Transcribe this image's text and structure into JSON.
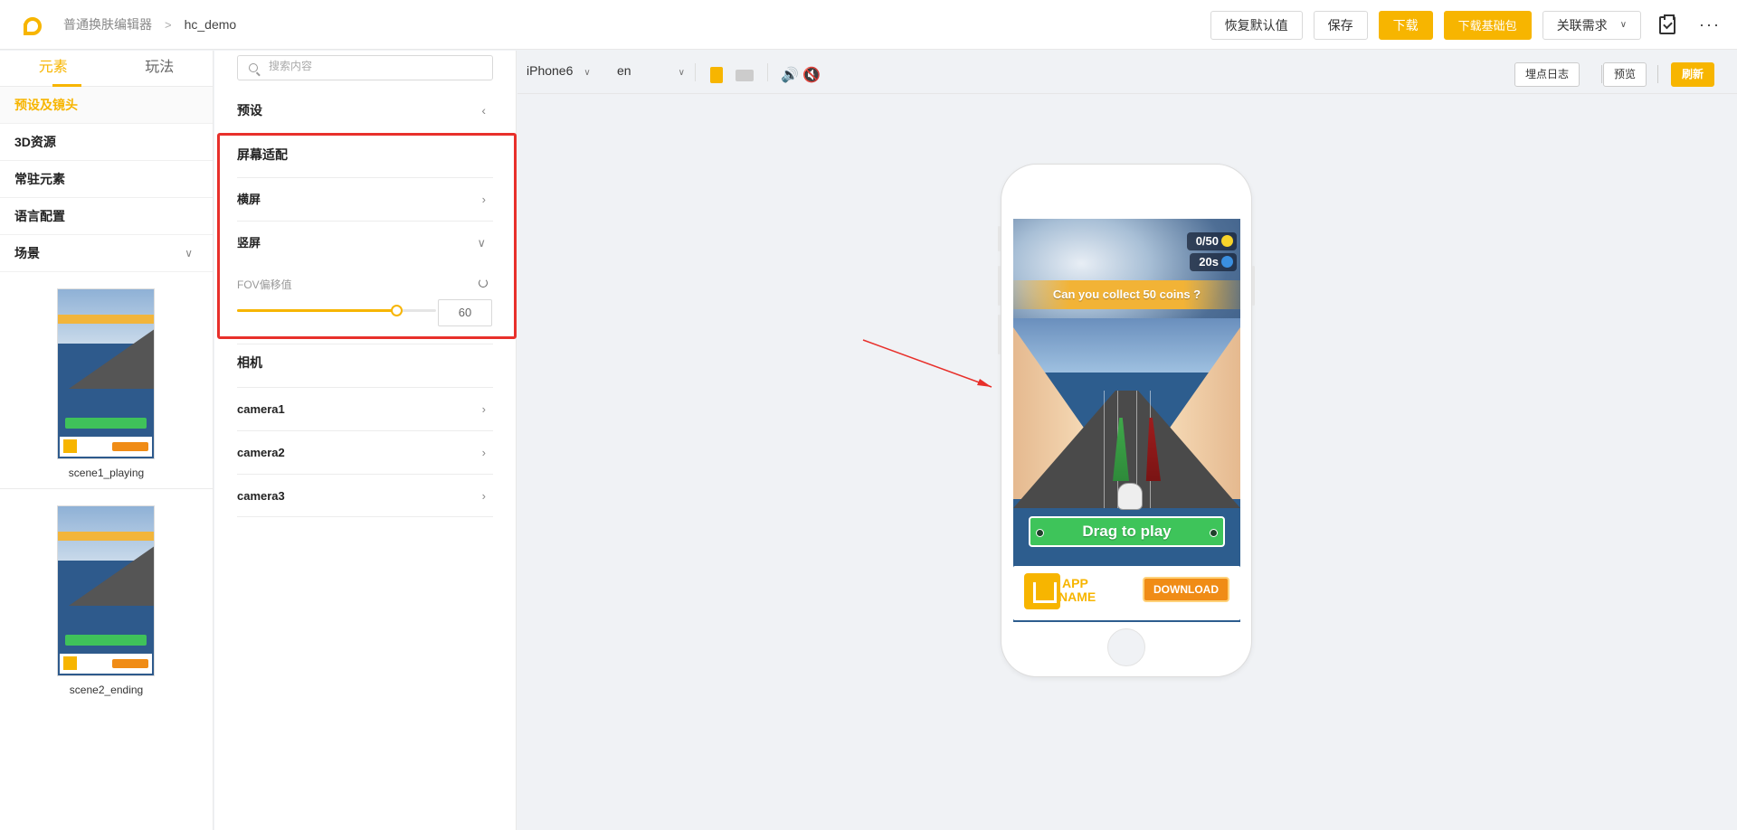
{
  "topbar": {
    "breadcrumb_root": "普通换肤编辑器",
    "breadcrumb_separator": ">",
    "breadcrumb_current": "hc_demo",
    "actions": {
      "restore": "恢复默认值",
      "save": "保存",
      "download": "下载",
      "download_base": "下载基础包",
      "related": "关联需求"
    },
    "more": "···"
  },
  "left": {
    "tabs": [
      "元素",
      "玩法"
    ],
    "active_tab": "元素",
    "nav": [
      "预设及镜头",
      "3D资源",
      "常驻元素",
      "语言配置",
      "场景"
    ],
    "active_nav": "预设及镜头",
    "scenes": [
      "scene1_playing",
      "scene2_ending"
    ]
  },
  "middle": {
    "search_placeholder": "搜索内容",
    "preset_title": "预设",
    "screen_adapt_title": "屏幕适配",
    "landscape": "横屏",
    "portrait": "竖屏",
    "fov_label": "FOV偏移值",
    "fov_value": "60",
    "fov_slider_fraction": 0.8,
    "camera_title": "相机",
    "cameras": [
      "camera1",
      "camera2",
      "camera3"
    ]
  },
  "preview": {
    "device": "iPhone6",
    "language": "en",
    "log_button": "埋点日志",
    "preview_button": "预览",
    "refresh_button": "刷新",
    "accent_color": "#f7b500"
  },
  "game": {
    "coins": "0/50",
    "timer": "20s",
    "question": "Can you collect 50 coins ?",
    "drag_label": "Drag to play",
    "app_name_line1": "APP",
    "app_name_line2": "NAME",
    "download_label": "DOWNLOAD"
  }
}
